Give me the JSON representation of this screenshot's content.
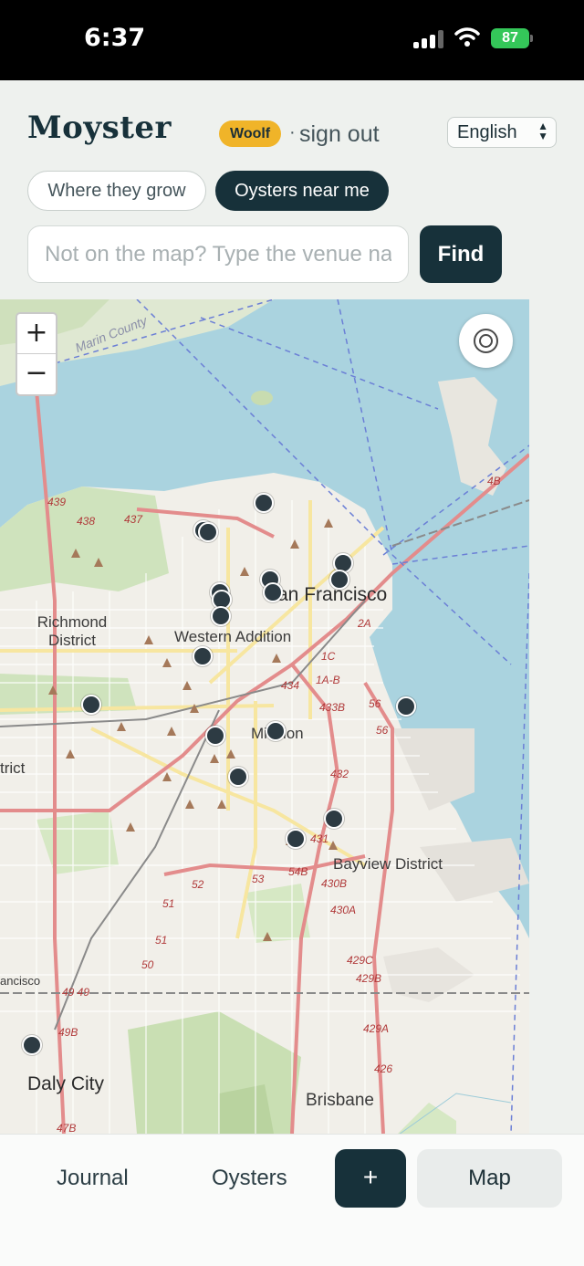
{
  "status_bar": {
    "time": "6:37",
    "battery": "87",
    "icons": [
      "signal-icon",
      "wifi-icon",
      "battery-icon"
    ]
  },
  "header": {
    "brand": "Moyster",
    "user_badge": "Woolf",
    "separator": "·",
    "sign_out": "sign out",
    "language": "English",
    "language_caret": "▲▼"
  },
  "tabs": [
    {
      "label": "Where they grow",
      "active": false
    },
    {
      "label": "Oysters near me",
      "active": true
    }
  ],
  "search": {
    "placeholder": "Not on the map? Type the venue name",
    "value": "",
    "button_label": "Find"
  },
  "map": {
    "zoom_in": "+",
    "zoom_out": "−",
    "locate_icon": "locate-icon",
    "labels": {
      "san_francisco": "San Francisco",
      "richmond": "Richmond District",
      "western_addition": "Western Addition",
      "mission": "Mission",
      "bayview": "Bayview District",
      "daly_city": "Daly City",
      "brisbane": "Brisbane",
      "marin": "Marin County",
      "district_fragment": "trict",
      "sf_fragment": "ancisco"
    },
    "pin_count": 21
  },
  "bottom_nav": {
    "journal": "Journal",
    "oysters": "Oysters",
    "add": "+",
    "map": "Map",
    "active": "Map"
  },
  "colors": {
    "brand_dark": "#17313a",
    "badge": "#f0b429",
    "battery": "#34c759",
    "water": "#aad3df",
    "pin": "#2d3b43"
  }
}
